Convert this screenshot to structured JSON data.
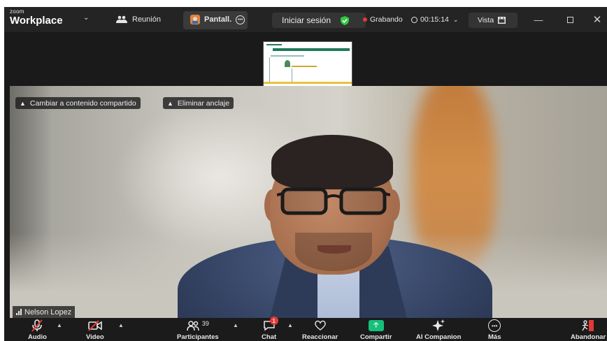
{
  "titlebar": {
    "logo_small": "zoom",
    "logo_big": "Workplace",
    "meeting_tab": "Reunión",
    "share_tab": "Pantall.",
    "signin": "Iniciar sesión",
    "recording": "Grabando",
    "timer": "00:15:14",
    "view": "Vista",
    "icons": [
      "chevron-down-icon",
      "people-icon",
      "screen-share-icon",
      "more-icon",
      "shield-check-icon",
      "record-dot-icon",
      "clock-icon",
      "grid-icon",
      "minimize-icon",
      "maximize-icon",
      "close-icon"
    ],
    "colors": {
      "shield": "#2ecc40",
      "record": "#e53935",
      "accent": "#0e71eb"
    }
  },
  "pins": {
    "switch_label": "Cambiar a contenido compartido",
    "unpin_label": "Eliminar anclaje"
  },
  "participant": {
    "name": "Nelson Lopez"
  },
  "toolbar": {
    "audio": "Audio",
    "video": "Video",
    "participants": "Participantes",
    "participant_count": "39",
    "chat": "Chat",
    "chat_badge": "1",
    "react": "Reaccionar",
    "share": "Compartir",
    "ai": "AI Companion",
    "more": "Más",
    "leave": "Abandonar",
    "colors": {
      "share": "#16c07a",
      "muted": "#e53935",
      "badge": "#e53935"
    }
  }
}
